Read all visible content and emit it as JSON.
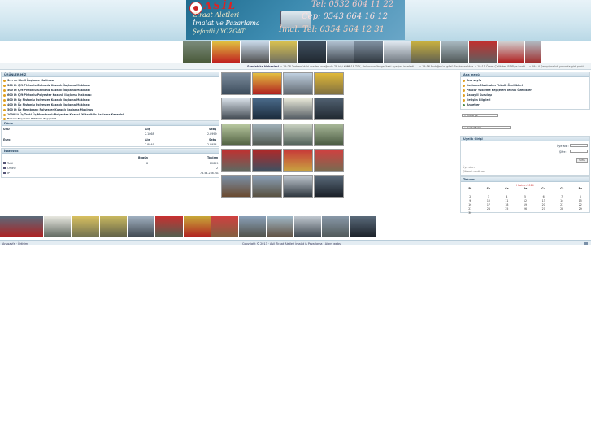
{
  "header": {
    "brand": "ASİL",
    "line1": "Ziraat Aletleri",
    "line2": "İmalat ve Pazarlama",
    "line3": "Şefaatli / YOZGAT",
    "phone1": "Tel: 0532 604 11 22",
    "phone2": "Cep: 0543 664 16 12",
    "phone3": "İmal. Tel: 0354 564 12 31"
  },
  "ticker": {
    "label": "Sondakika Haberleri",
    "items": [
      "» 19:28  Trabzon'daki maden ocağında 78 kişi öldü",
      "» 19:18  TSK, Balyoz'un Yozgat'taki ayağını inceledi",
      "» 19:16  Erdoğan'ın gözü Başbakanlıkta",
      "» 19:15  Ömer Çelik'ten BDP'ye hodri",
      "» 19:14  Şampiyonluk yolunda gidi parti"
    ]
  },
  "left": {
    "products_title": "ÜRÜNLERİMİZ",
    "products": [
      "Sıvı ve Kimil İlaçlama Makinası",
      "500 Lt Çift Pistonlu Galvaniz Kazanlı İlaçlama Makinası",
      "500 Lt Çift Pistonlu Galvaniz Kazanlı İlaçlama Makinası",
      "600 Lt Çift Pistonlu Polyester Kazanlı İlaçlama Makinası",
      "800 Lt Üç Pistonlu Polyester Kazanlı İlaçlama Makinası",
      "400 Lt Üç Pistonlu Polyester Kazanlı İlaçlama Makinası",
      "500 Lt Üç Membranlı Polyester Kazanlı İlaçlama Makinası",
      "1000 Lt Üç Takti Üç Membranlı Polyester Kazanlı Yükseltilir İlaçlama Kesenisi",
      "Pancar Kaşılama Yükleme Kepçeleri"
    ],
    "currency_title": "Döviz",
    "currency_headers": [
      "Alış",
      "Satış"
    ],
    "currency": [
      {
        "name": "USD",
        "buy": "2.1068",
        "sell": "2.0999"
      },
      {
        "name": "Euro",
        "buy": "2.8949",
        "sell": "2.8954"
      }
    ],
    "stats_title": "İstatistik",
    "stats_headers": [
      "Bugün",
      "Toplam"
    ],
    "stats": [
      {
        "name": "Tekil",
        "today": "8",
        "total": "22899"
      },
      {
        "name": "Online",
        "today": "",
        "total": "2"
      },
      {
        "name": "IP",
        "today": "",
        "total": "78.54.238.201"
      }
    ]
  },
  "right": {
    "menu_title": "Ana menü",
    "menu": [
      "Ana sayfa",
      "İlaçlama Makinaları Teknik Özellikleri",
      "Pancar Yükleme Kepçeleri Teknik Özellikleri",
      "Sanayili Kuruluşı",
      "İletişim Bilgileri",
      "Anketler"
    ],
    "select1": "» Ürüne git",
    "select2": "» Dosit Modül",
    "login_title": "Üyelik Girişi",
    "username_label": "Üye adı :",
    "password_label": "Şifre :",
    "login_button": "Giriş",
    "register_link": "Üye olun",
    "forgot_link": "Şifremi unuttum",
    "calendar_title": "Takvim",
    "calendar_caption": "Haziran 2014",
    "calendar_headers": [
      "Pt",
      "Sa",
      "Ça",
      "Pe",
      "Cu",
      "Ct",
      "Pz"
    ],
    "calendar_rows": [
      [
        "",
        "",
        "",
        "",
        "",
        "",
        "1"
      ],
      [
        "2",
        "3",
        "4",
        "5",
        "6",
        "7",
        "8"
      ],
      [
        "9",
        "10",
        "11",
        "12",
        "13",
        "14",
        "15"
      ],
      [
        "16",
        "17",
        "18",
        "19",
        "20",
        "21",
        "22"
      ],
      [
        "23",
        "24",
        "25",
        "26",
        "27",
        "28",
        "29"
      ],
      [
        "30",
        "",
        "",
        "",
        "",
        "",
        ""
      ]
    ]
  },
  "footer": {
    "left": "Anasayfa · İletişim",
    "center": "Copyright © 2013 · Asil Ziraat Aletleri İmalat & Pazarlama · Ajans webs"
  }
}
